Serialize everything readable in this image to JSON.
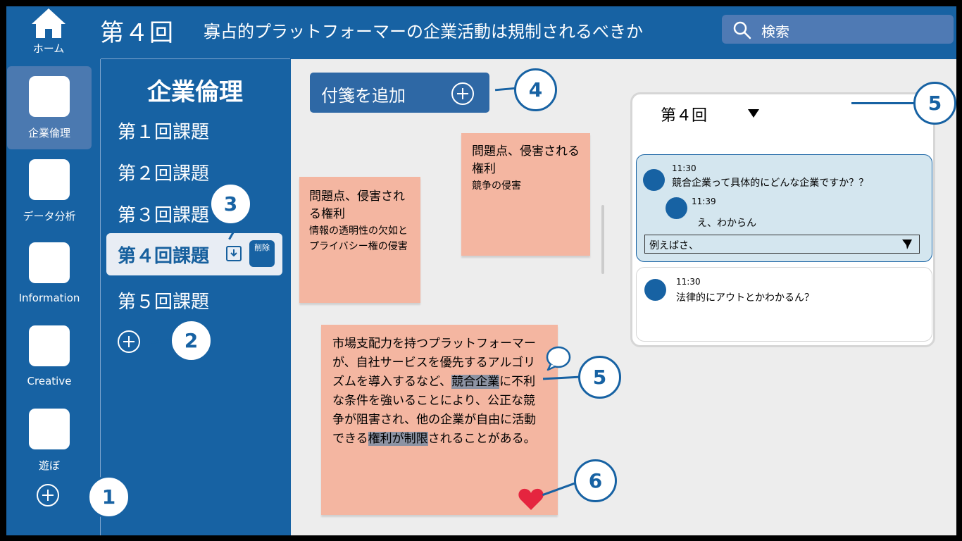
{
  "header": {
    "home_label": "ホーム",
    "round": "第４回",
    "title": "寡占的プラットフォーマーの企業活動は規制されるべきか",
    "search_placeholder": "検索"
  },
  "rail": {
    "items": [
      {
        "label": "企業倫理"
      },
      {
        "label": "データ分析"
      },
      {
        "label": "Information"
      },
      {
        "label": "Creative"
      },
      {
        "label": "遊ぼ"
      }
    ]
  },
  "course": {
    "title": "企業倫理",
    "lessons": [
      "第１回課題",
      "第２回課題",
      "第３回課題",
      "第４回課題",
      "第５回課題"
    ],
    "delete_label": "削除"
  },
  "canvas": {
    "add_note_label": "付箋を追加",
    "notes": [
      {
        "heading": "問題点、侵害される権利",
        "body": "情報の透明性の欠如とプライバシー権の侵害"
      },
      {
        "heading": "問題点、侵害される権利",
        "body": "競争の侵害"
      }
    ],
    "main_note": {
      "part1": "市場支配力を持つプラットフォーマーが、自社サービスを優先するアルゴリズムを導入するなど、",
      "hl1": "競合企業",
      "part2": "に不利な条件を強いることにより、公正な競争が阻害され、他の企業が自由に活動できる",
      "hl2": "権利が制限",
      "part3": "されることがある。"
    }
  },
  "chat": {
    "header": "第４回",
    "threads": [
      {
        "time": "11:30",
        "text": "競合企業って具体的にどんな企業ですか？？",
        "reply_time": "11:39",
        "reply_text": "え、わからん",
        "input_value": "例えばさ、"
      },
      {
        "time": "11:30",
        "text": "法律的にアウトとかわかるん？"
      }
    ]
  },
  "callouts": [
    "1",
    "2",
    "3",
    "4",
    "5",
    "5",
    "6"
  ],
  "colors": {
    "primary": "#1762a3",
    "note": "#f4b6a1",
    "highlight": "#8d93a3",
    "heart": "#e5253f"
  }
}
